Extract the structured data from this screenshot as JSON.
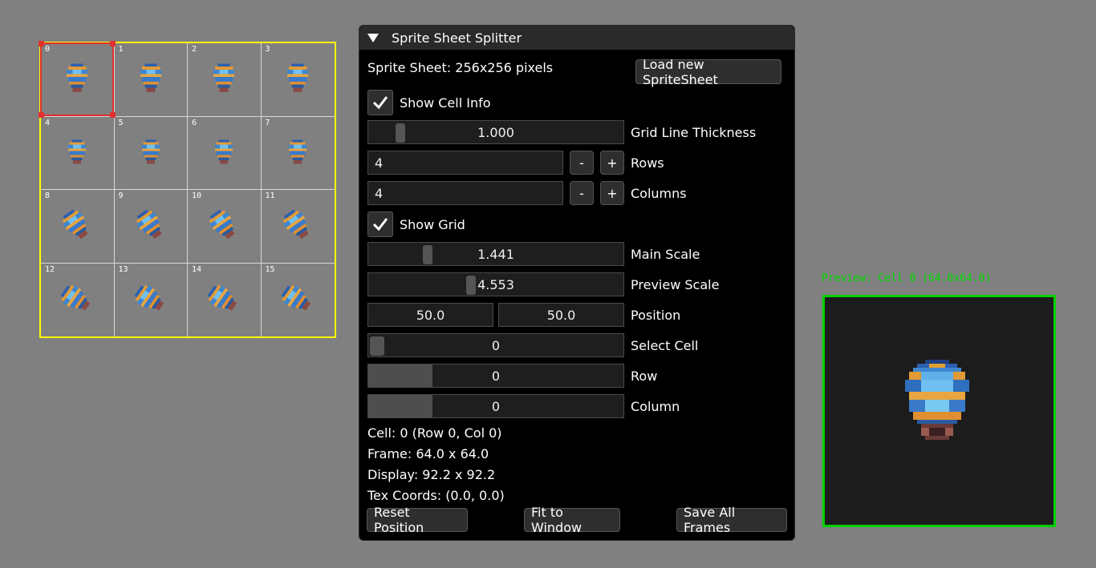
{
  "sheet": {
    "cells": [
      "0",
      "1",
      "2",
      "3",
      "4",
      "5",
      "6",
      "7",
      "8",
      "9",
      "10",
      "11",
      "12",
      "13",
      "14",
      "15"
    ]
  },
  "panel": {
    "title": "Sprite Sheet Splitter",
    "sheet_info": "Sprite Sheet: 256x256 pixels",
    "load_button": "Load new SpriteSheet",
    "show_cell_info": {
      "label": "Show Cell Info",
      "checked": true
    },
    "grid_line_thickness": {
      "value": "1.000",
      "label": "Grid Line Thickness"
    },
    "rows": {
      "value": "4",
      "label": "Rows",
      "minus": "-",
      "plus": "+"
    },
    "columns": {
      "value": "4",
      "label": "Columns",
      "minus": "-",
      "plus": "+"
    },
    "show_grid": {
      "label": "Show Grid",
      "checked": true
    },
    "main_scale": {
      "value": "1.441",
      "label": "Main Scale"
    },
    "preview_scale": {
      "value": "4.553",
      "label": "Preview Scale"
    },
    "position": {
      "x": "50.0",
      "y": "50.0",
      "label": "Position"
    },
    "select_cell": {
      "value": "0",
      "label": "Select Cell"
    },
    "row": {
      "value": "0",
      "label": "Row"
    },
    "column": {
      "value": "0",
      "label": "Column"
    },
    "info": {
      "cell": "Cell: 0 (Row 0, Col 0)",
      "frame": "Frame: 64.0 x 64.0",
      "display": "Display: 92.2 x 92.2",
      "tex": "Tex Coords: (0.0, 0.0)"
    },
    "buttons": {
      "reset": "Reset Position",
      "fit": "Fit to Window",
      "save": "Save All Frames"
    }
  },
  "preview": {
    "label": "Preview: Cell 0 (64.0x64.0)"
  },
  "colors": {
    "grid_border": "#ffff00",
    "selection": "#e03030",
    "preview_border": "#00d000"
  }
}
